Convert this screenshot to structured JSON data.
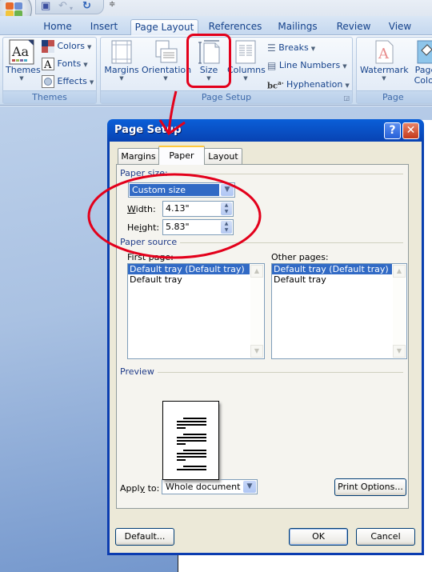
{
  "quick_access": {
    "office_button": "office-button",
    "save": "save-icon",
    "undo": "undo-icon",
    "redo": "redo-icon",
    "customize": "customize-qat-icon"
  },
  "tabs": [
    {
      "label": "Home"
    },
    {
      "label": "Insert"
    },
    {
      "label": "Page Layout",
      "active": true
    },
    {
      "label": "References"
    },
    {
      "label": "Mailings"
    },
    {
      "label": "Review"
    },
    {
      "label": "View"
    }
  ],
  "ribbon": {
    "themes_group": {
      "label": "Themes",
      "themes_button": "Themes",
      "colors": "Colors",
      "fonts": "Fonts",
      "effects": "Effects"
    },
    "page_setup_group": {
      "label": "Page Setup",
      "margins": "Margins",
      "orientation": "Orientation",
      "size": "Size",
      "columns": "Columns",
      "breaks": "Breaks",
      "line_numbers": "Line Numbers",
      "hyphenation": "Hyphenation"
    },
    "page_background_group": {
      "label": "Page Backgr",
      "watermark": "Watermark",
      "page_color_line1": "Page",
      "page_color_line2": "Color"
    }
  },
  "dialog": {
    "title": "Page Setup",
    "help": "?",
    "close": "✕",
    "tabs": [
      {
        "label": "Margins"
      },
      {
        "label": "Paper",
        "active": true
      },
      {
        "label": "Layout"
      }
    ],
    "paper_size": {
      "section": "Paper size:",
      "selected": "Custom size",
      "width_label": "Width:",
      "width_value": "4.13\"",
      "height_label": "Height:",
      "height_value": "5.83\""
    },
    "paper_source": {
      "section": "Paper source",
      "first_page_label": "First page:",
      "first_page_items": [
        "Default tray (Default tray)",
        "Default tray"
      ],
      "first_page_selected": 0,
      "other_pages_label": "Other pages:",
      "other_pages_items": [
        "Default tray (Default tray)",
        "Default tray"
      ],
      "other_pages_selected": 0
    },
    "preview": {
      "section": "Preview"
    },
    "apply_to_label": "Apply to:",
    "apply_to_value": "Whole document",
    "print_options": "Print Options...",
    "default_button": "Default...",
    "ok": "OK",
    "cancel": "Cancel"
  },
  "annotations": {
    "color": "#e3001b"
  }
}
